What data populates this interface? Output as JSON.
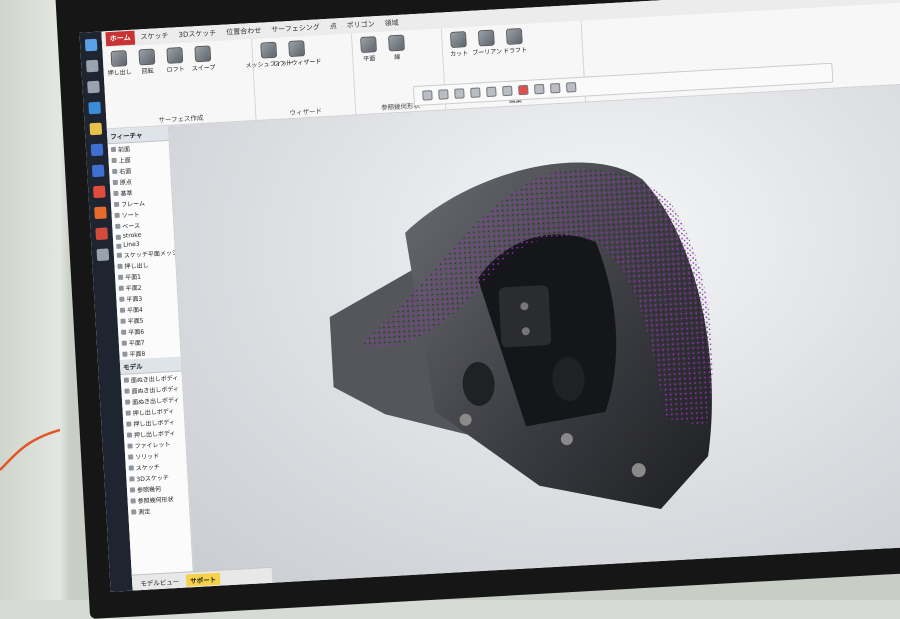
{
  "ribbon": {
    "tabs": [
      "ホーム",
      "スケッチ",
      "3Dスケッチ",
      "位置合わせ",
      "サーフェシング",
      "点",
      "ポリゴン",
      "領域"
    ],
    "active_tab_index": 0,
    "groups": [
      {
        "label": "サーフェス作成",
        "tools": [
          "押し出し",
          "回転",
          "ロフト",
          "スイープ"
        ]
      },
      {
        "label": "ウィザード",
        "tools": [
          "メッシュフィット",
          "ロフトウィザード"
        ]
      },
      {
        "label": "参照幾何形状",
        "tools": [
          "平面",
          "線"
        ]
      },
      {
        "label": "編集",
        "tools": [
          "カット",
          "ブーリアン",
          "ドラフト"
        ]
      }
    ]
  },
  "tree": {
    "header": "フィーチャ",
    "items": [
      "前面",
      "上面",
      "右面",
      "原点",
      "基準",
      "フレーム",
      "ソート",
      "ベース",
      "stroke",
      "Line3",
      "スケッチ平面メッシュ",
      "押し出し",
      "平面1",
      "平面2",
      "平面3",
      "平面4",
      "平面5",
      "平面6",
      "平面7",
      "平面8"
    ],
    "model_header": "モデル",
    "model_items": [
      "面ぬき出しボディ",
      "面ぬき出しボディ",
      "面ぬき出しボディ",
      "押し出しボディ",
      "押し出しボディ",
      "押し出しボディ",
      "ファイレット",
      "ソリッド",
      "スケッチ",
      "3Dスケッチ",
      "参照幾何",
      "参照幾何形状",
      "測定"
    ]
  },
  "bottom_tabs": {
    "labels": [
      "モデルビュー",
      "サポート"
    ],
    "active_index": 1
  },
  "colors": {
    "accent_tab": "#c83333",
    "scan_points": "#a528c8",
    "model_body": "#3c3d42",
    "active_bottom_tab": "#f6d248"
  }
}
